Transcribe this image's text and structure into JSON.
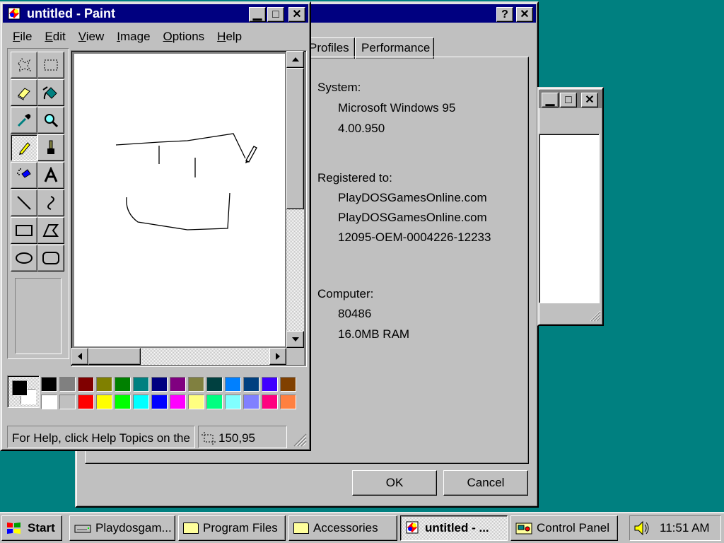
{
  "sysprops": {
    "tabs": [
      "Profiles",
      "Performance"
    ],
    "system_label": "System:",
    "os_name": "Microsoft Windows 95",
    "os_version": "4.00.950",
    "registered_label": "Registered to:",
    "registered_name": "PlayDOSGamesOnline.com",
    "registered_org": "PlayDOSGamesOnline.com",
    "product_id": "12095-OEM-0004226-12233",
    "computer_label": "Computer:",
    "cpu": "80486",
    "ram": "16.0MB RAM",
    "ok_label": "OK",
    "cancel_label": "Cancel",
    "help_btn": "?",
    "close_btn": "✕"
  },
  "bgwindow": {
    "minimize": "▁",
    "maximize": "□",
    "close": "✕"
  },
  "paint": {
    "title": "untitled - Paint",
    "minimize": "▁",
    "maximize": "□",
    "close": "✕",
    "menu": [
      {
        "key": "F",
        "rest": "ile"
      },
      {
        "key": "E",
        "rest": "dit"
      },
      {
        "key": "V",
        "rest": "iew"
      },
      {
        "key": "I",
        "rest": "mage"
      },
      {
        "key": "O",
        "rest": "ptions"
      },
      {
        "key": "H",
        "rest": "elp"
      }
    ],
    "tools": [
      "free-form-select",
      "rectangle-select",
      "eraser",
      "fill-with-color",
      "pick-color",
      "magnifier",
      "pencil",
      "brush",
      "airbrush",
      "text",
      "line",
      "curve",
      "rectangle",
      "polygon",
      "ellipse",
      "rounded-rectangle"
    ],
    "selected_tool": "pencil",
    "palette_top": [
      "#000000",
      "#808080",
      "#800000",
      "#808000",
      "#008000",
      "#008080",
      "#000080",
      "#800080",
      "#808040",
      "#004040",
      "#0080ff",
      "#004080",
      "#4000ff",
      "#804000"
    ],
    "palette_bottom": [
      "#ffffff",
      "#c0c0c0",
      "#ff0000",
      "#ffff00",
      "#00ff00",
      "#00ffff",
      "#0000ff",
      "#ff00ff",
      "#ffff80",
      "#00ff80",
      "#80ffff",
      "#8080ff",
      "#ff0080",
      "#ff8040"
    ],
    "foreground_color": "#000000",
    "background_color": "#ffffff",
    "status_text": "For Help, click Help Topics on the",
    "coords": "150,95"
  },
  "taskbar": {
    "start_label": "Start",
    "items": [
      {
        "label": "Playdosgam...",
        "icon": "drive-icon",
        "active": false
      },
      {
        "label": "Program Files",
        "icon": "folder-icon",
        "active": false
      },
      {
        "label": "Accessories",
        "icon": "folder-icon",
        "active": false
      },
      {
        "label": "untitled - ...",
        "icon": "paint-icon",
        "active": true
      },
      {
        "label": "Control Panel",
        "icon": "control-panel-icon",
        "active": false
      }
    ],
    "clock": "11:51 AM"
  }
}
